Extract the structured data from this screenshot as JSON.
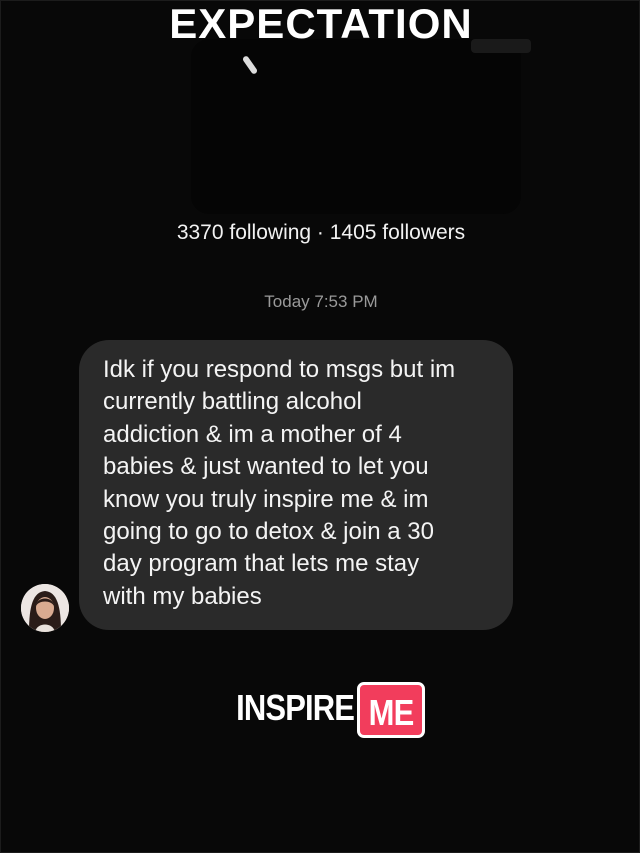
{
  "overlay_title": "EXPECTATION",
  "profile": {
    "stats": "3370 following · 1405 followers"
  },
  "conversation": {
    "timestamp": "Today 7:53 PM",
    "message": {
      "lines": "Idk if you respond to msgs but im\ncurrently battling alcohol\naddiction & im a mother of 4\nbabies & just wanted to let you\nknow you truly inspire me & im\ngoing to go to detox & join a 30\nday program that lets me stay\nwith my babies"
    }
  },
  "caption": {
    "plain": "INSPIRE",
    "highlight": "ME",
    "highlight_color": "#f23d5c"
  },
  "colors": {
    "background": "#080808",
    "bubble": "#2a2a2a",
    "timestamp": "#9a9a9a"
  }
}
